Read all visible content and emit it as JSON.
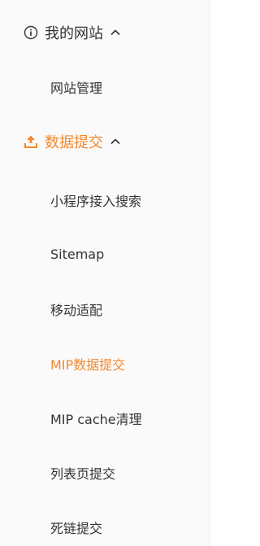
{
  "colors": {
    "accent": "#f5882b",
    "text": "#333333",
    "sidebar_bg": "#fafafa"
  },
  "sidebar": {
    "groups": [
      {
        "label": "我的网站",
        "icon": "info-circle-icon",
        "expanded": true,
        "items": [
          {
            "label": "网站管理",
            "active": false
          }
        ]
      },
      {
        "label": "数据提交",
        "icon": "upload-icon",
        "expanded": true,
        "active": true,
        "items": [
          {
            "label": "小程序接入搜索",
            "active": false
          },
          {
            "label": "Sitemap",
            "active": false
          },
          {
            "label": "移动适配",
            "active": false
          },
          {
            "label": "MIP数据提交",
            "active": true
          },
          {
            "label": "MIP cache清理",
            "active": false
          },
          {
            "label": "列表页提交",
            "active": false
          },
          {
            "label": "死链提交",
            "active": false
          }
        ]
      }
    ]
  }
}
